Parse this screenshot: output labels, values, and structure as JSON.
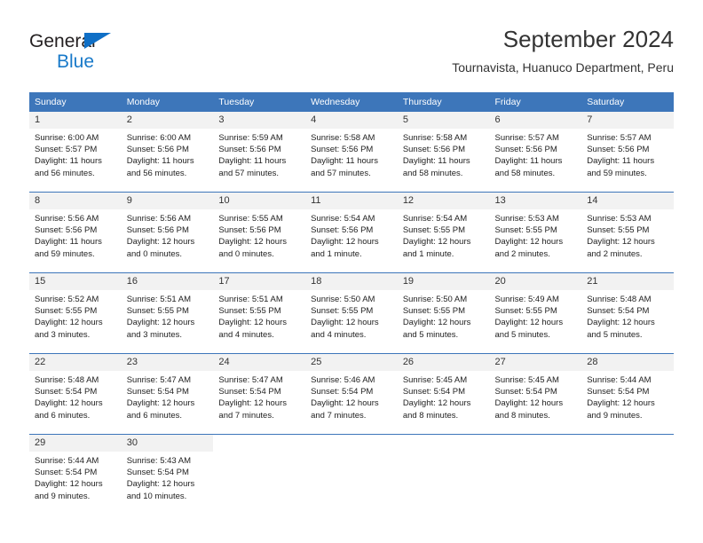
{
  "logo": {
    "line1": "General",
    "line2": "Blue",
    "triangle_icon": "triangle-icon",
    "brand_blue": "#1879c9",
    "text_dark": "#231f20"
  },
  "header": {
    "title": "September 2024",
    "subtitle": "Tournavista, Huanuco Department, Peru"
  },
  "colors": {
    "header_blue": "#3d76ba",
    "daynum_bg": "#f2f2f2",
    "text": "#222222"
  },
  "calendar": {
    "weekday_headers": [
      "Sunday",
      "Monday",
      "Tuesday",
      "Wednesday",
      "Thursday",
      "Friday",
      "Saturday"
    ],
    "weeks": [
      [
        {
          "day": "1",
          "sunrise": "Sunrise: 6:00 AM",
          "sunset": "Sunset: 5:57 PM",
          "daylight1": "Daylight: 11 hours",
          "daylight2": "and 56 minutes."
        },
        {
          "day": "2",
          "sunrise": "Sunrise: 6:00 AM",
          "sunset": "Sunset: 5:56 PM",
          "daylight1": "Daylight: 11 hours",
          "daylight2": "and 56 minutes."
        },
        {
          "day": "3",
          "sunrise": "Sunrise: 5:59 AM",
          "sunset": "Sunset: 5:56 PM",
          "daylight1": "Daylight: 11 hours",
          "daylight2": "and 57 minutes."
        },
        {
          "day": "4",
          "sunrise": "Sunrise: 5:58 AM",
          "sunset": "Sunset: 5:56 PM",
          "daylight1": "Daylight: 11 hours",
          "daylight2": "and 57 minutes."
        },
        {
          "day": "5",
          "sunrise": "Sunrise: 5:58 AM",
          "sunset": "Sunset: 5:56 PM",
          "daylight1": "Daylight: 11 hours",
          "daylight2": "and 58 minutes."
        },
        {
          "day": "6",
          "sunrise": "Sunrise: 5:57 AM",
          "sunset": "Sunset: 5:56 PM",
          "daylight1": "Daylight: 11 hours",
          "daylight2": "and 58 minutes."
        },
        {
          "day": "7",
          "sunrise": "Sunrise: 5:57 AM",
          "sunset": "Sunset: 5:56 PM",
          "daylight1": "Daylight: 11 hours",
          "daylight2": "and 59 minutes."
        }
      ],
      [
        {
          "day": "8",
          "sunrise": "Sunrise: 5:56 AM",
          "sunset": "Sunset: 5:56 PM",
          "daylight1": "Daylight: 11 hours",
          "daylight2": "and 59 minutes."
        },
        {
          "day": "9",
          "sunrise": "Sunrise: 5:56 AM",
          "sunset": "Sunset: 5:56 PM",
          "daylight1": "Daylight: 12 hours",
          "daylight2": "and 0 minutes."
        },
        {
          "day": "10",
          "sunrise": "Sunrise: 5:55 AM",
          "sunset": "Sunset: 5:56 PM",
          "daylight1": "Daylight: 12 hours",
          "daylight2": "and 0 minutes."
        },
        {
          "day": "11",
          "sunrise": "Sunrise: 5:54 AM",
          "sunset": "Sunset: 5:56 PM",
          "daylight1": "Daylight: 12 hours",
          "daylight2": "and 1 minute."
        },
        {
          "day": "12",
          "sunrise": "Sunrise: 5:54 AM",
          "sunset": "Sunset: 5:55 PM",
          "daylight1": "Daylight: 12 hours",
          "daylight2": "and 1 minute."
        },
        {
          "day": "13",
          "sunrise": "Sunrise: 5:53 AM",
          "sunset": "Sunset: 5:55 PM",
          "daylight1": "Daylight: 12 hours",
          "daylight2": "and 2 minutes."
        },
        {
          "day": "14",
          "sunrise": "Sunrise: 5:53 AM",
          "sunset": "Sunset: 5:55 PM",
          "daylight1": "Daylight: 12 hours",
          "daylight2": "and 2 minutes."
        }
      ],
      [
        {
          "day": "15",
          "sunrise": "Sunrise: 5:52 AM",
          "sunset": "Sunset: 5:55 PM",
          "daylight1": "Daylight: 12 hours",
          "daylight2": "and 3 minutes."
        },
        {
          "day": "16",
          "sunrise": "Sunrise: 5:51 AM",
          "sunset": "Sunset: 5:55 PM",
          "daylight1": "Daylight: 12 hours",
          "daylight2": "and 3 minutes."
        },
        {
          "day": "17",
          "sunrise": "Sunrise: 5:51 AM",
          "sunset": "Sunset: 5:55 PM",
          "daylight1": "Daylight: 12 hours",
          "daylight2": "and 4 minutes."
        },
        {
          "day": "18",
          "sunrise": "Sunrise: 5:50 AM",
          "sunset": "Sunset: 5:55 PM",
          "daylight1": "Daylight: 12 hours",
          "daylight2": "and 4 minutes."
        },
        {
          "day": "19",
          "sunrise": "Sunrise: 5:50 AM",
          "sunset": "Sunset: 5:55 PM",
          "daylight1": "Daylight: 12 hours",
          "daylight2": "and 5 minutes."
        },
        {
          "day": "20",
          "sunrise": "Sunrise: 5:49 AM",
          "sunset": "Sunset: 5:55 PM",
          "daylight1": "Daylight: 12 hours",
          "daylight2": "and 5 minutes."
        },
        {
          "day": "21",
          "sunrise": "Sunrise: 5:48 AM",
          "sunset": "Sunset: 5:54 PM",
          "daylight1": "Daylight: 12 hours",
          "daylight2": "and 5 minutes."
        }
      ],
      [
        {
          "day": "22",
          "sunrise": "Sunrise: 5:48 AM",
          "sunset": "Sunset: 5:54 PM",
          "daylight1": "Daylight: 12 hours",
          "daylight2": "and 6 minutes."
        },
        {
          "day": "23",
          "sunrise": "Sunrise: 5:47 AM",
          "sunset": "Sunset: 5:54 PM",
          "daylight1": "Daylight: 12 hours",
          "daylight2": "and 6 minutes."
        },
        {
          "day": "24",
          "sunrise": "Sunrise: 5:47 AM",
          "sunset": "Sunset: 5:54 PM",
          "daylight1": "Daylight: 12 hours",
          "daylight2": "and 7 minutes."
        },
        {
          "day": "25",
          "sunrise": "Sunrise: 5:46 AM",
          "sunset": "Sunset: 5:54 PM",
          "daylight1": "Daylight: 12 hours",
          "daylight2": "and 7 minutes."
        },
        {
          "day": "26",
          "sunrise": "Sunrise: 5:45 AM",
          "sunset": "Sunset: 5:54 PM",
          "daylight1": "Daylight: 12 hours",
          "daylight2": "and 8 minutes."
        },
        {
          "day": "27",
          "sunrise": "Sunrise: 5:45 AM",
          "sunset": "Sunset: 5:54 PM",
          "daylight1": "Daylight: 12 hours",
          "daylight2": "and 8 minutes."
        },
        {
          "day": "28",
          "sunrise": "Sunrise: 5:44 AM",
          "sunset": "Sunset: 5:54 PM",
          "daylight1": "Daylight: 12 hours",
          "daylight2": "and 9 minutes."
        }
      ],
      [
        {
          "day": "29",
          "sunrise": "Sunrise: 5:44 AM",
          "sunset": "Sunset: 5:54 PM",
          "daylight1": "Daylight: 12 hours",
          "daylight2": "and 9 minutes."
        },
        {
          "day": "30",
          "sunrise": "Sunrise: 5:43 AM",
          "sunset": "Sunset: 5:54 PM",
          "daylight1": "Daylight: 12 hours",
          "daylight2": "and 10 minutes."
        },
        {
          "day": "",
          "sunrise": "",
          "sunset": "",
          "daylight1": "",
          "daylight2": ""
        },
        {
          "day": "",
          "sunrise": "",
          "sunset": "",
          "daylight1": "",
          "daylight2": ""
        },
        {
          "day": "",
          "sunrise": "",
          "sunset": "",
          "daylight1": "",
          "daylight2": ""
        },
        {
          "day": "",
          "sunrise": "",
          "sunset": "",
          "daylight1": "",
          "daylight2": ""
        },
        {
          "day": "",
          "sunrise": "",
          "sunset": "",
          "daylight1": "",
          "daylight2": ""
        }
      ]
    ]
  }
}
